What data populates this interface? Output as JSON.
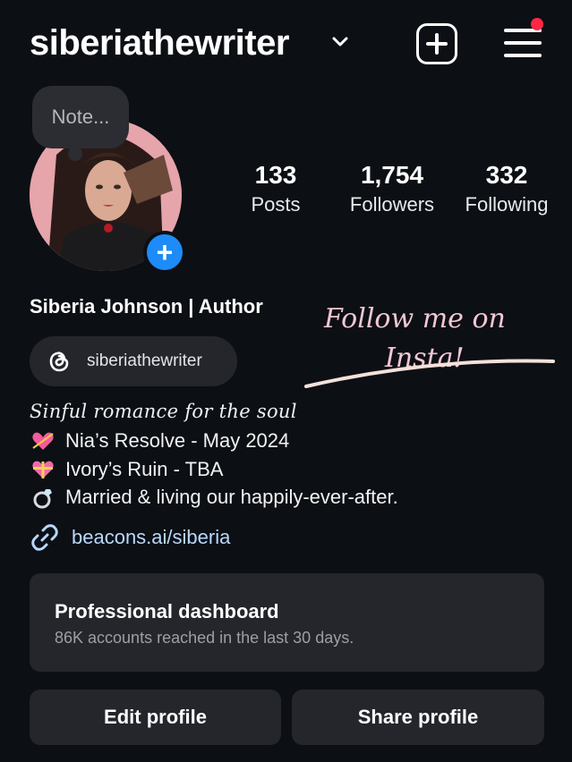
{
  "header": {
    "username": "siberiathewriter",
    "icons": {
      "dropdown": "chevron-down-icon",
      "create": "plus-square-icon",
      "menu": "hamburger-menu-icon"
    },
    "notification_color": "#ff2744"
  },
  "note": {
    "placeholder": "Note..."
  },
  "stats": [
    {
      "value": "133",
      "label": "Posts"
    },
    {
      "value": "1,754",
      "label": "Followers"
    },
    {
      "value": "332",
      "label": "Following"
    }
  ],
  "profile": {
    "display_name": "Siberia Johnson | Author",
    "threads_handle": "siberiathewriter",
    "script_overlay": {
      "line1": "Follow me on",
      "line2": "Insta!"
    },
    "tagline": "Sinful romance for the soul",
    "bio": [
      {
        "emoji": "cupid-heart-icon",
        "text": "Nia’s Resolve - May 2024"
      },
      {
        "emoji": "gift-heart-icon",
        "text": "Ivory’s Ruin - TBA"
      },
      {
        "emoji": "ring-icon",
        "text": "Married & living our happily-ever-after."
      }
    ],
    "link": "beacons.ai/siberia"
  },
  "dashboard": {
    "title": "Professional dashboard",
    "subtitle": "86K accounts reached in the last 30 days."
  },
  "actions": {
    "edit": "Edit profile",
    "share": "Share profile"
  },
  "colors": {
    "background": "#0c0f14",
    "surface": "#24262c",
    "accent_blue": "#1d8cf8",
    "link": "#b8d8ff"
  }
}
